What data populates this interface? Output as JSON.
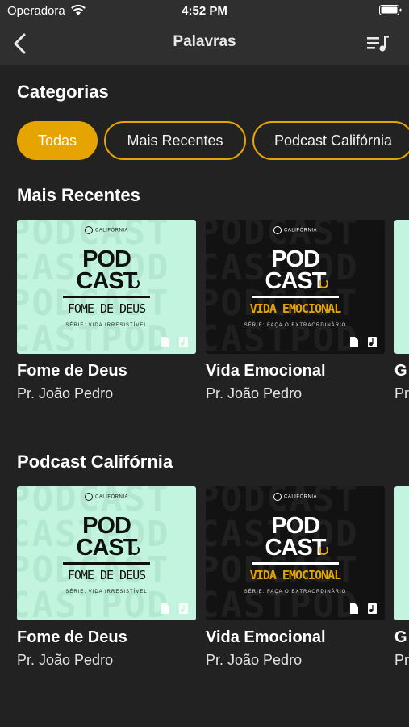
{
  "status_bar": {
    "carrier": "Operadora",
    "time": "4:52 PM",
    "wifi_icon": "wifi-icon",
    "battery_icon": "battery-icon"
  },
  "nav": {
    "title": "Palavras",
    "back_icon": "chevron-left-icon",
    "playlist_icon": "playlist-icon"
  },
  "categories": {
    "heading": "Categorias",
    "chips": [
      {
        "label": "Todas",
        "active": true
      },
      {
        "label": "Mais Recentes",
        "active": false
      },
      {
        "label": "Podcast Califórnia",
        "active": false
      }
    ]
  },
  "sections": [
    {
      "heading": "Mais Recentes",
      "cards": [
        {
          "title": "Fome de Deus",
          "speaker": "Pr. João Pedro",
          "thumb": {
            "style": "light",
            "brand": "CALIFÓRNIA",
            "pod": "POD",
            "cast": "CAST",
            "episode": "FOME DE DEUS",
            "series": "SÉRIE: VIDA IRRESISTÍVEL"
          }
        },
        {
          "title": "Vida Emocional",
          "speaker": "Pr. João Pedro",
          "thumb": {
            "style": "dark",
            "brand": "CALIFÓRNIA",
            "pod": "POD",
            "cast": "CAST",
            "episode": "VIDA EMOCIONAL",
            "series": "SÉRIE: FAÇA O EXTRAORDINÁRIO"
          }
        },
        {
          "title": "G",
          "speaker": "Pr",
          "thumb": {
            "style": "light"
          }
        }
      ]
    },
    {
      "heading": "Podcast Califórnia",
      "cards": [
        {
          "title": "Fome de Deus",
          "speaker": "Pr. João Pedro",
          "thumb": {
            "style": "light",
            "brand": "CALIFÓRNIA",
            "pod": "POD",
            "cast": "CAST",
            "episode": "FOME DE DEUS",
            "series": "SÉRIE: VIDA IRRESISTÍVEL"
          }
        },
        {
          "title": "Vida Emocional",
          "speaker": "Pr. João Pedro",
          "thumb": {
            "style": "dark",
            "brand": "CALIFÓRNIA",
            "pod": "POD",
            "cast": "CAST",
            "episode": "VIDA EMOCIONAL",
            "series": "SÉRIE: FAÇA O EXTRAORDINÁRIO"
          }
        },
        {
          "title": "G",
          "speaker": "Pr",
          "thumb": {
            "style": "light"
          }
        }
      ]
    }
  ],
  "colors": {
    "accent": "#e6a400",
    "background": "#222222",
    "bar": "#2f2f2f",
    "thumb_light": "#c3f4df",
    "thumb_dark": "#121212"
  }
}
